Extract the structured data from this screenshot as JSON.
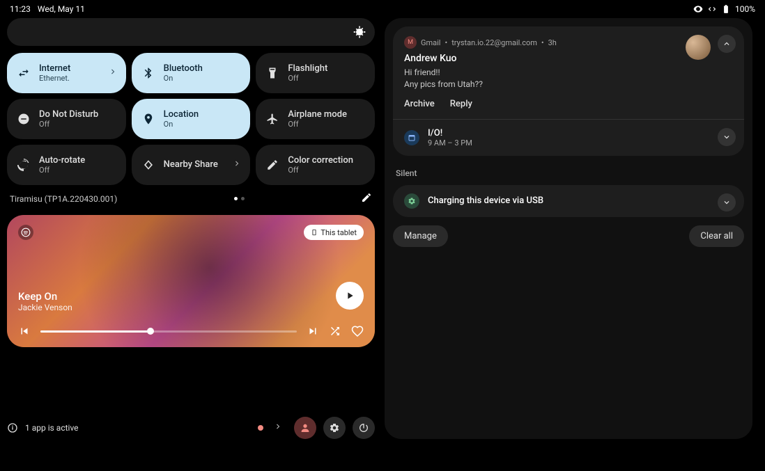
{
  "status": {
    "time": "11:23",
    "date": "Wed, May 11",
    "battery": "100%"
  },
  "tiles": [
    {
      "title": "Internet",
      "sub": "Ethernet.",
      "active": true,
      "chevron": true,
      "icon": "swap"
    },
    {
      "title": "Bluetooth",
      "sub": "On",
      "active": true,
      "icon": "bluetooth"
    },
    {
      "title": "Flashlight",
      "sub": "Off",
      "icon": "flashlight"
    },
    {
      "title": "Do Not Disturb",
      "sub": "Off",
      "icon": "dnd"
    },
    {
      "title": "Location",
      "sub": "On",
      "active": true,
      "icon": "location"
    },
    {
      "title": "Airplane mode",
      "sub": "Off",
      "icon": "airplane"
    },
    {
      "title": "Auto-rotate",
      "sub": "Off",
      "icon": "rotate"
    },
    {
      "title": "Nearby Share",
      "sub": "",
      "chevron": true,
      "icon": "nearby"
    },
    {
      "title": "Color correction",
      "sub": "Off",
      "icon": "color"
    }
  ],
  "build": "Tiramisu (TP1A.220430.001)",
  "media": {
    "device": "This tablet",
    "title": "Keep On",
    "artist": "Jackie Venson"
  },
  "bottom": {
    "apps_active": "1 app is active"
  },
  "notifications": {
    "gmail": {
      "app": "Gmail",
      "account": "trystan.io.22@gmail.com",
      "time": "3h",
      "sender": "Andrew Kuo",
      "line1": "Hi friend!!",
      "line2": "Any pics from Utah??",
      "action1": "Archive",
      "action2": "Reply"
    },
    "calendar": {
      "title": "I/O!",
      "time": "9 AM – 3 PM"
    },
    "silent_label": "Silent",
    "system": {
      "text": "Charging this device via USB"
    },
    "manage": "Manage",
    "clear": "Clear all"
  }
}
